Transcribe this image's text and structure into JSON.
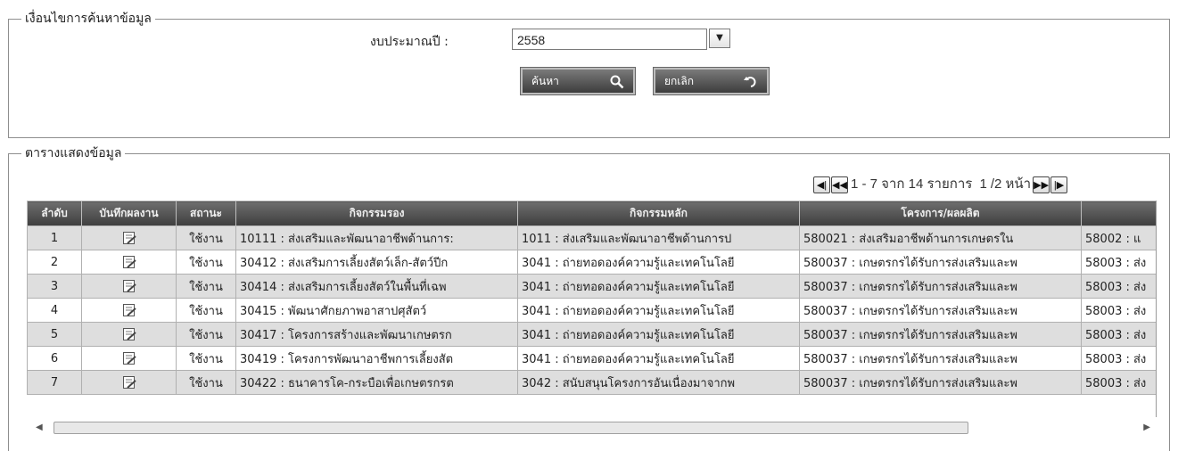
{
  "search_panel": {
    "legend": "เงื่อนไขการค้นหาข้อมูล",
    "year_label": "งบประมาณปี :",
    "year_value": "2558",
    "search_label": "ค้นหา",
    "cancel_label": "ยกเลิก"
  },
  "grid_panel": {
    "legend": "ตารางแสดงข้อมูล",
    "pager": {
      "summary": "1 - 7 จาก 14 รายการ",
      "page": "1",
      "total": "/2 หน้า"
    },
    "columns": [
      "ลำดับ",
      "บันทึกผลงาน",
      "สถานะ",
      "กิจกรรมรอง",
      "กิจกรรมหลัก",
      "โครงการ/ผลผลิต",
      ""
    ],
    "rows": [
      {
        "no": "1",
        "status": "ใช้งาน",
        "sub": "10111 : ส่งเสริมและพัฒนาอาชีพด้านการ:",
        "main": "1011 : ส่งเสริมและพัฒนาอาชีพด้านการป",
        "project": "580021 : ส่งเสริมอาชีพด้านการเกษตรใน",
        "extra": "58002 : แ"
      },
      {
        "no": "2",
        "status": "ใช้งาน",
        "sub": "30412 : ส่งเสริมการเลี้ยงสัตว์เล็ก-สัตว์ปีก",
        "main": "3041 : ถ่ายทอดองค์ความรู้และเทคโนโลยี",
        "project": "580037 : เกษตรกรได้รับการส่งเสริมและพ",
        "extra": "58003 : ส่ง"
      },
      {
        "no": "3",
        "status": "ใช้งาน",
        "sub": "30414 : ส่งเสริมการเลี้ยงสัตว์ในพื้นที่เฉพ",
        "main": "3041 : ถ่ายทอดองค์ความรู้และเทคโนโลยี",
        "project": "580037 : เกษตรกรได้รับการส่งเสริมและพ",
        "extra": "58003 : ส่ง"
      },
      {
        "no": "4",
        "status": "ใช้งาน",
        "sub": "30415 : พัฒนาศักยภาพอาสาปศุสัตว์",
        "main": "3041 : ถ่ายทอดองค์ความรู้และเทคโนโลยี",
        "project": "580037 : เกษตรกรได้รับการส่งเสริมและพ",
        "extra": "58003 : ส่ง"
      },
      {
        "no": "5",
        "status": "ใช้งาน",
        "sub": "30417 : โครงการสร้างและพัฒนาเกษตรก",
        "main": "3041 : ถ่ายทอดองค์ความรู้และเทคโนโลยี",
        "project": "580037 : เกษตรกรได้รับการส่งเสริมและพ",
        "extra": "58003 : ส่ง"
      },
      {
        "no": "6",
        "status": "ใช้งาน",
        "sub": "30419 : โครงการพัฒนาอาชีพการเลี้ยงสัต",
        "main": "3041 : ถ่ายทอดองค์ความรู้และเทคโนโลยี",
        "project": "580037 : เกษตรกรได้รับการส่งเสริมและพ",
        "extra": "58003 : ส่ง"
      },
      {
        "no": "7",
        "status": "ใช้งาน",
        "sub": "30422 : ธนาคารโค-กระบือเพื่อเกษตรกรต",
        "main": "3042 : สนับสนุนโครงการอันเนื่องมาจากพ",
        "project": "580037 : เกษตรกรได้รับการส่งเสริมและพ",
        "extra": "58003 : ส่ง"
      }
    ]
  },
  "icons": {
    "search": "magnifier-icon",
    "cancel": "undo-arrow-icon",
    "record": "edit-note-icon"
  }
}
